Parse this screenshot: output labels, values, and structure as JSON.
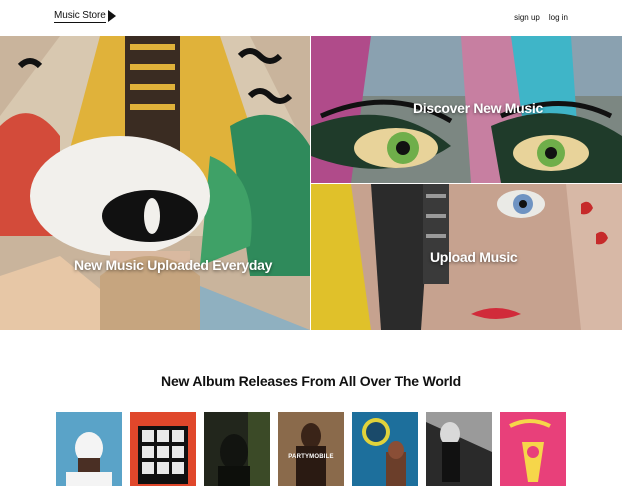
{
  "header": {
    "logo_text": "Music Store",
    "logo_icon": "play-icon",
    "nav": {
      "signup": "sign up",
      "login": "log in"
    }
  },
  "hero": {
    "left_label": "New Music Uploaded Everyday",
    "top_right_label": "Discover New Music",
    "bottom_right_label": "Upload Music"
  },
  "releases": {
    "title": "New Album Releases From All Over The World",
    "albums": [
      {
        "name": "album-1",
        "color": "#5aa3c8"
      },
      {
        "name": "album-2",
        "color": "#e0472b"
      },
      {
        "name": "album-3",
        "color": "#22261c"
      },
      {
        "name": "album-4",
        "color": "#8a6a4b",
        "cover_text": "PARTYMOBILE"
      },
      {
        "name": "album-5",
        "color": "#1d6f9c"
      },
      {
        "name": "album-6",
        "color": "#9a9a9a"
      },
      {
        "name": "album-7",
        "color": "#e8407a"
      }
    ]
  }
}
